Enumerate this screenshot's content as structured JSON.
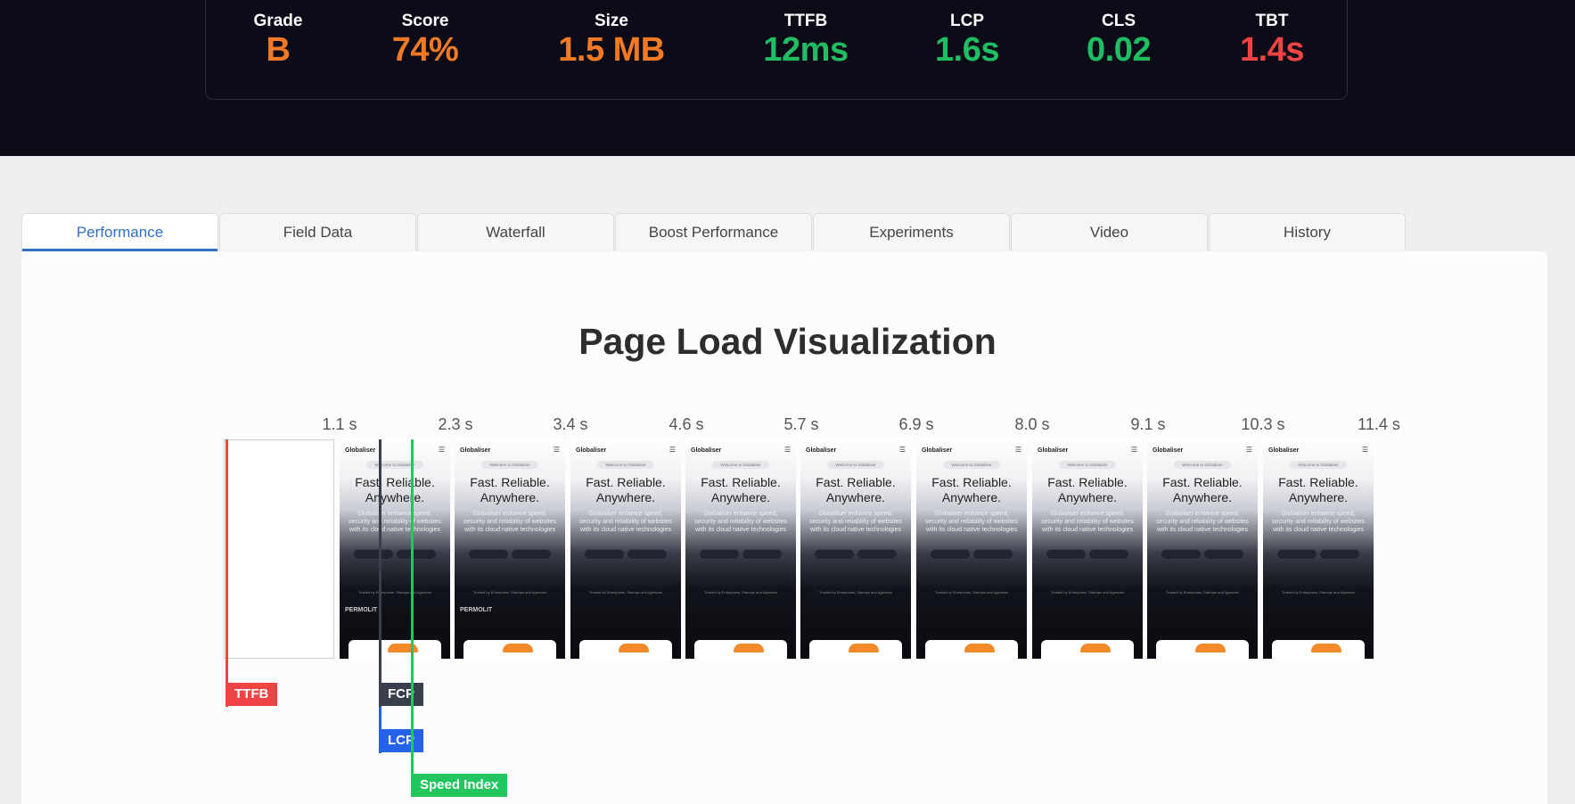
{
  "metrics": [
    {
      "label": "Grade",
      "value": "B",
      "color": "#f27a24"
    },
    {
      "label": "Score",
      "value": "74%",
      "color": "#f27a24"
    },
    {
      "label": "Size",
      "value": "1.5 MB",
      "color": "#f27a24"
    },
    {
      "label": "TTFB",
      "value": "12ms",
      "color": "#1fbe63"
    },
    {
      "label": "LCP",
      "value": "1.6s",
      "color": "#1fbe63"
    },
    {
      "label": "CLS",
      "value": "0.02",
      "color": "#1fbe63"
    },
    {
      "label": "TBT",
      "value": "1.4s",
      "color": "#ef4444"
    }
  ],
  "tabs": [
    {
      "label": "Performance",
      "active": true
    },
    {
      "label": "Field Data"
    },
    {
      "label": "Waterfall"
    },
    {
      "label": "Boost Performance"
    },
    {
      "label": "Experiments"
    },
    {
      "label": "Video"
    },
    {
      "label": "History"
    }
  ],
  "visualization": {
    "title": "Page Load Visualization",
    "ticks": [
      "1.1 s",
      "2.3 s",
      "3.4 s",
      "4.6 s",
      "5.7 s",
      "6.9 s",
      "8.0 s",
      "9.1 s",
      "10.3 s",
      "11.4 s"
    ],
    "frame_text": {
      "logo": "Globaliser",
      "welcome": "Welcome to Globaliser",
      "headline_1": "Fast. Reliable.",
      "headline_2": "Anywhere.",
      "subtitle": "Globaliser enhance speed, security and reliability of websites with its cloud native technologies",
      "trusted": "Trusted by Enterprises, Startups and Agencies",
      "logos": "PERMOLIT"
    },
    "markers": [
      {
        "label": "TTFB",
        "color": "#ef4444"
      },
      {
        "label": "FCP",
        "color": "#3a3f4e"
      },
      {
        "label": "LCP",
        "color": "#2563eb"
      },
      {
        "label": "Speed Index",
        "color": "#22c55e"
      }
    ]
  }
}
